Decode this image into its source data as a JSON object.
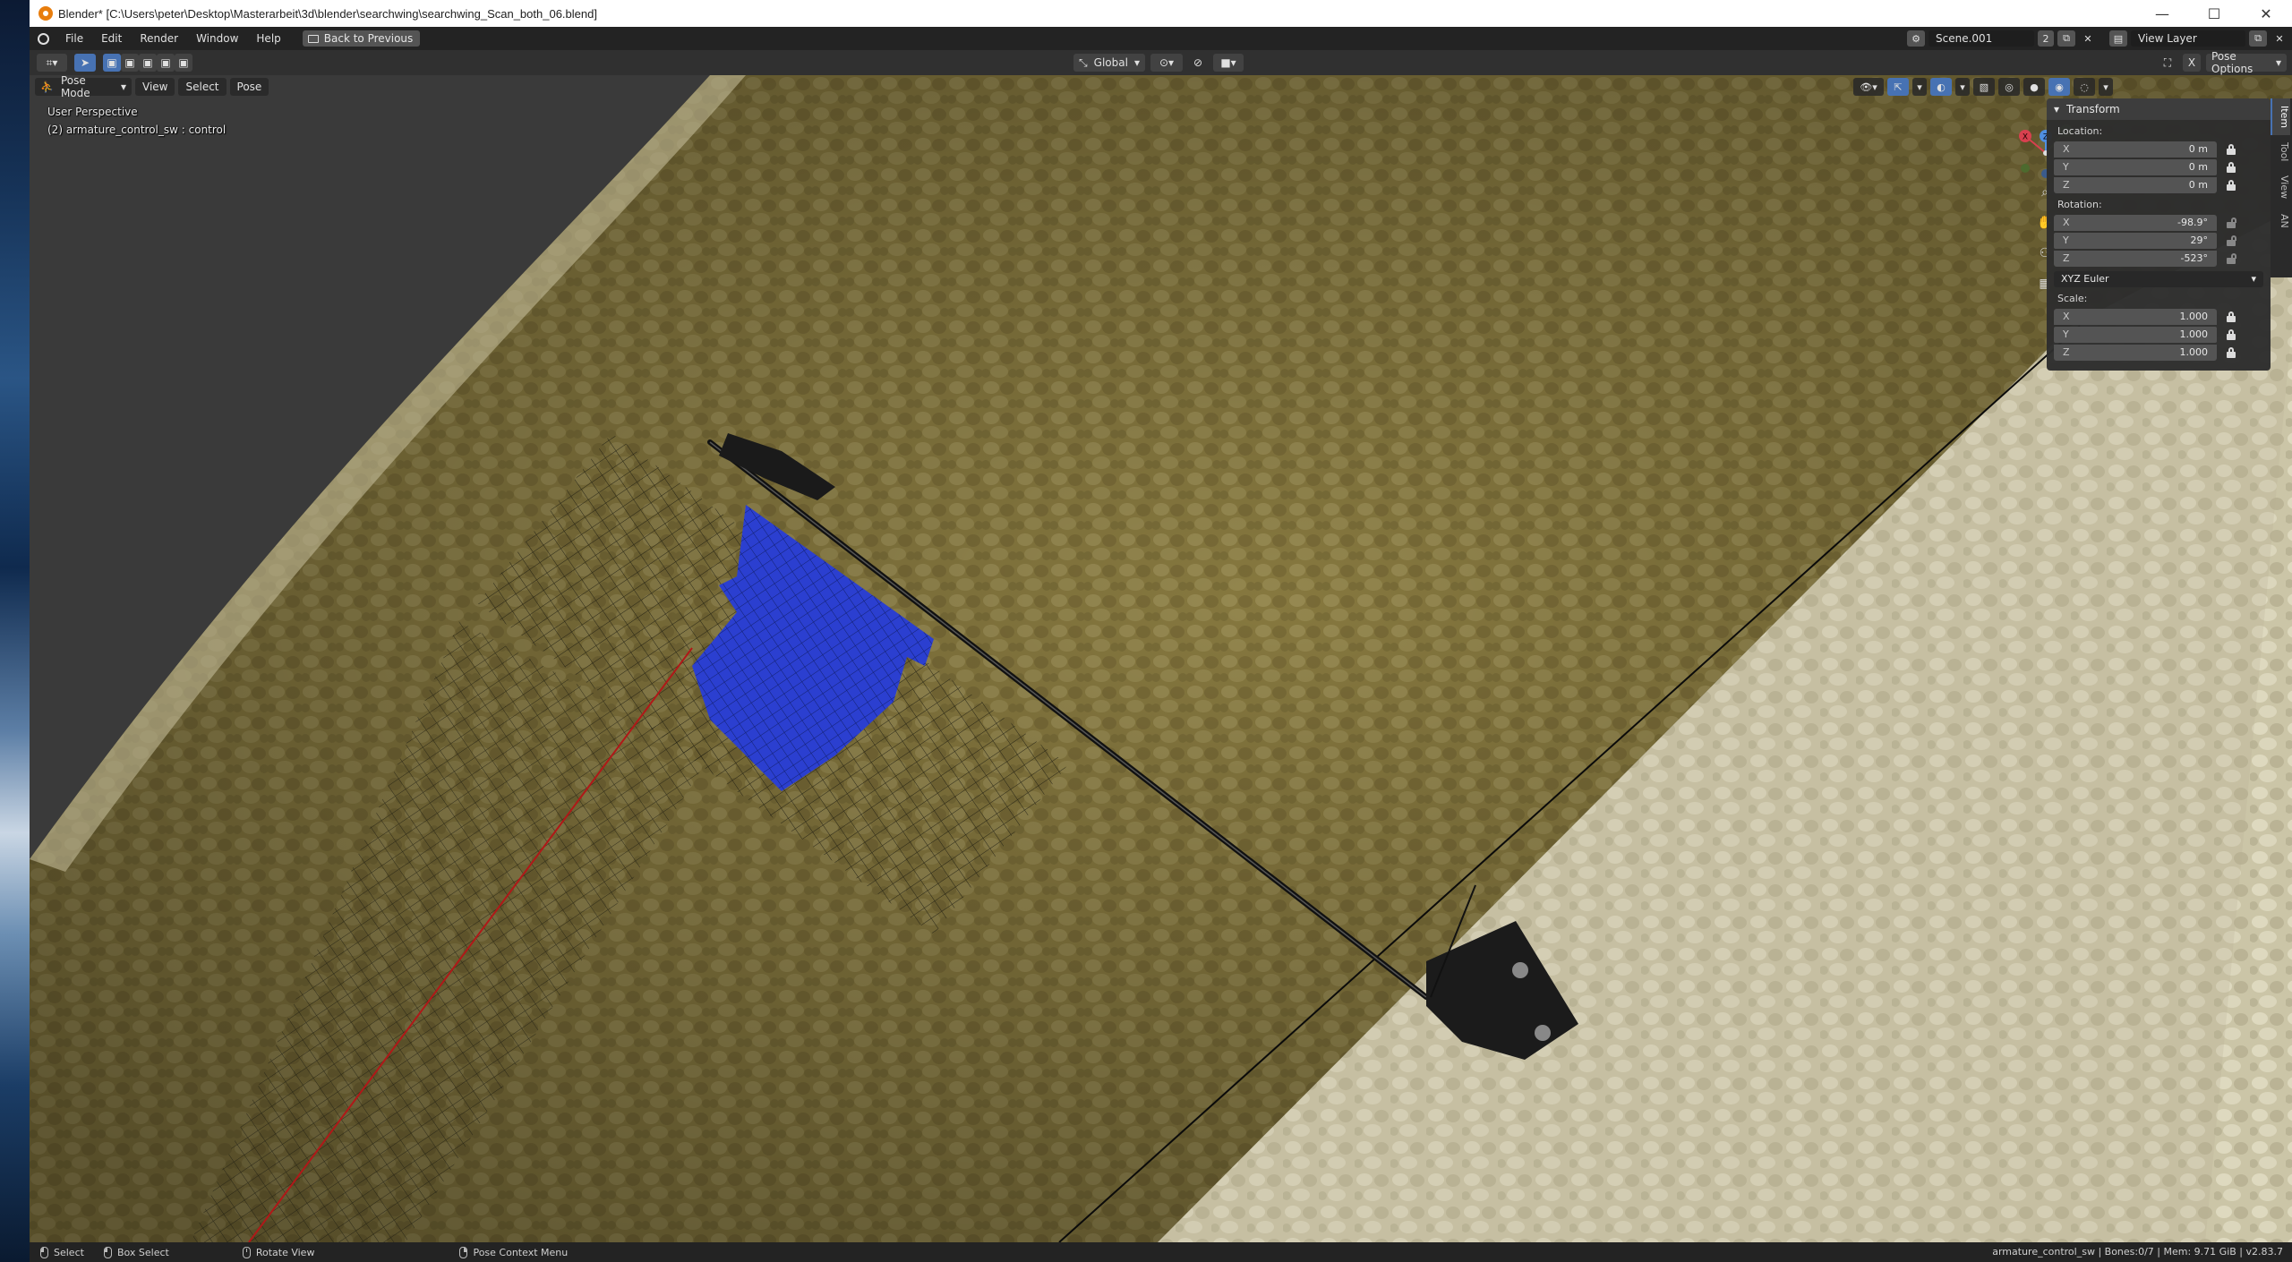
{
  "window": {
    "title": "Blender* [C:\\Users\\peter\\Desktop\\Masterarbeit\\3d\\blender\\searchwing\\searchwing_Scan_both_06.blend]",
    "controls": [
      "—",
      "☐",
      "✕"
    ]
  },
  "topbar": {
    "menus": [
      "File",
      "Edit",
      "Render",
      "Window",
      "Help"
    ],
    "back_button": "Back to Previous",
    "scene_name": "Scene.001",
    "scene_users": "2",
    "view_layer": "View Layer"
  },
  "header": {
    "transform_orientation": "Global",
    "pose_options": "Pose Options"
  },
  "viewport": {
    "mode": "Pose Mode",
    "menus": [
      "View",
      "Select",
      "Pose"
    ],
    "perspective_label": "User Perspective",
    "object_label": "(2) armature_control_sw : control",
    "gizmo_axes": {
      "x": "X",
      "y": "Y",
      "z": "Z"
    }
  },
  "npanel": {
    "section": "Transform",
    "location_label": "Location:",
    "location": [
      {
        "axis": "X",
        "value": "0 m"
      },
      {
        "axis": "Y",
        "value": "0 m"
      },
      {
        "axis": "Z",
        "value": "0 m"
      }
    ],
    "rotation_label": "Rotation:",
    "rotation": [
      {
        "axis": "X",
        "value": "-98.9°"
      },
      {
        "axis": "Y",
        "value": "29°"
      },
      {
        "axis": "Z",
        "value": "-523°"
      }
    ],
    "rotation_mode": "XYZ Euler",
    "scale_label": "Scale:",
    "scale": [
      {
        "axis": "X",
        "value": "1.000"
      },
      {
        "axis": "Y",
        "value": "1.000"
      },
      {
        "axis": "Z",
        "value": "1.000"
      }
    ],
    "tabs": [
      "Item",
      "Tool",
      "View",
      "AN"
    ]
  },
  "statusbar": {
    "select": "Select",
    "box_select": "Box Select",
    "rotate_view": "Rotate View",
    "context_menu": "Pose Context Menu",
    "stats": "armature_control_sw | Bones:0/7 | Mem: 9.71 GiB | v2.83.7"
  },
  "colors": {
    "accent": "#4772b3",
    "foam": "#8a7a46",
    "foam_light": "#cfc9ad",
    "bone_blue": "#2a3fd4"
  }
}
